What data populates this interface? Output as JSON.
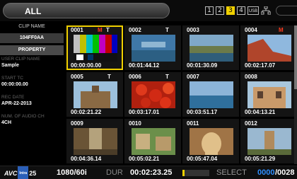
{
  "topbar": {
    "filter_label": "ALL",
    "slots": [
      "1",
      "2",
      "3",
      "4"
    ],
    "active_slot": "3",
    "sd_label": "USB"
  },
  "side": {
    "clip_name_header": "CLIP NAME",
    "clip_name_value": "104FF0AA",
    "property_label": "PROPERTY",
    "user_clip_name_label": "USER CLIP NAME",
    "user_clip_name_value": "Sample",
    "start_tc_label": "START TC",
    "start_tc_value": "00:00:00.00",
    "rec_date_label": "REC DATE",
    "rec_date_value": "APR-22-2013",
    "audio_label": "NUM. OF AUDIO CH",
    "audio_value": "4CH"
  },
  "clips": [
    {
      "num": "0001",
      "badges": [
        "M",
        "T"
      ],
      "duration": "00:00:00.00",
      "thumb": "color-bars-icon"
    },
    {
      "num": "0002",
      "badges": [
        "T"
      ],
      "duration": "00:01:44.12",
      "thumb": "coast-title-icon"
    },
    {
      "num": "0003",
      "badges": [],
      "duration": "00:01:30.09",
      "thumb": "harbor-icon"
    },
    {
      "num": "0004",
      "badges": [
        "M"
      ],
      "duration": "00:02:17.07",
      "thumb": "cliff-sea-icon"
    },
    {
      "num": "0005",
      "badges": [
        "T"
      ],
      "duration": "00:02:21.22",
      "thumb": "castle-icon"
    },
    {
      "num": "0006",
      "badges": [
        "T"
      ],
      "duration": "00:03:17.01",
      "thumb": "tomatoes-icon"
    },
    {
      "num": "0007",
      "badges": [],
      "duration": "00:03:51.17",
      "thumb": "sea-icon"
    },
    {
      "num": "0008",
      "badges": [],
      "duration": "00:04:13.21",
      "thumb": "building-icon"
    },
    {
      "num": "0009",
      "badges": [],
      "duration": "00:04:36.14",
      "thumb": "street-icon"
    },
    {
      "num": "0010",
      "badges": [],
      "duration": "00:05:02.21",
      "thumb": "town-icon"
    },
    {
      "num": "0011",
      "badges": [],
      "duration": "00:05:47.04",
      "thumb": "archway-icon"
    },
    {
      "num": "0012",
      "badges": [],
      "duration": "00:05:21.29",
      "thumb": "tower-icon"
    }
  ],
  "selected_clip": "0001",
  "bottombar": {
    "codec_a": "AVC",
    "codec_b": "Intra",
    "codec_n": "25",
    "format": "1080/60i",
    "dur_label": "DUR",
    "dur_value": "00:02:23.25",
    "dur_progress": 0.08,
    "select_label": "SELECT",
    "select_count": "0000",
    "total_count": "/0028"
  },
  "colors": {
    "accent": "#f0d000",
    "badge_m": "#ff3b1f",
    "select_count": "#2f8fff"
  }
}
